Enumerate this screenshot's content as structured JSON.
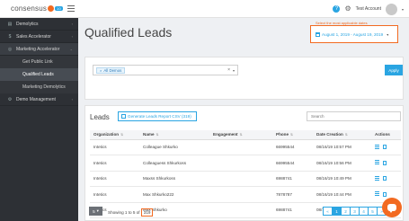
{
  "header": {
    "logo_text": "consensus",
    "logo_version": "10",
    "account_name": "Test Account"
  },
  "sidebar": {
    "items": [
      {
        "label": "Demolytics"
      },
      {
        "label": "Sales Accelerator"
      },
      {
        "label": "Marketing Accelerator"
      },
      {
        "label": "Get Public Link"
      },
      {
        "label": "Qualified Leads"
      },
      {
        "label": "Marketing Demolytics"
      },
      {
        "label": "Demo Management"
      }
    ]
  },
  "page": {
    "title": "Qualified Leads",
    "hint": "Select the most applicable dates",
    "date_range": "August 1, 2019 - August 19, 2019"
  },
  "filter": {
    "chip_label": "All Demos",
    "apply_label": "Apply"
  },
  "leads": {
    "title": "Leads",
    "report_button": "Generate Leads Report CSV (319)",
    "search_placeholder": "Search",
    "columns": [
      "Organization",
      "Name",
      "Engagement",
      "Phone",
      "Date Creation",
      "Actions"
    ],
    "rows": [
      {
        "org": "Intetics",
        "name": "Colleague Shkurko",
        "engagement": "",
        "phone": "66995544",
        "date": "08/16/19 10:57 PM"
      },
      {
        "org": "Intetics",
        "name": "Colleaguess Shkurkoss",
        "engagement": "",
        "phone": "66995544",
        "date": "08/16/19 10:56 PM"
      },
      {
        "org": "Intetics",
        "name": "Maxss Shkurkoss",
        "engagement": "",
        "phone": "6988741",
        "date": "08/16/19 10:49 PM"
      },
      {
        "org": "Intetics",
        "name": "Max Shkurko222",
        "engagement": "",
        "phone": "7878787",
        "date": "08/16/19 10:44 PM"
      },
      {
        "org": "Intetics",
        "name": "Max Shkurko",
        "engagement": "",
        "phone": "6988741",
        "date": "08/16/19 10:37 PM"
      }
    ]
  },
  "footer": {
    "page_size": "5",
    "showing_prefix": "Showing 1 to 5 of",
    "total": "319",
    "pages": [
      "«",
      "1",
      "2",
      "3",
      "4",
      "5",
      "»"
    ]
  }
}
